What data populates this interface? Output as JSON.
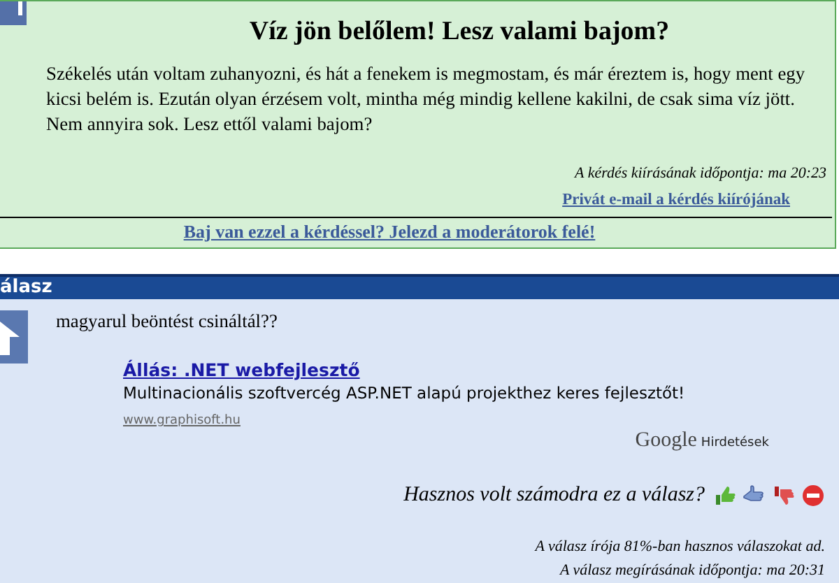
{
  "question": {
    "title": "Víz jön belőlem! Lesz valami bajom?",
    "body": "Székelés után voltam zuhanyozni, és hát a fenekem is megmostam, és már éreztem is, hogy ment egy kicsi belém is. Ezután olyan érzésem volt, mintha még mindig kellene kakilni, de csak sima víz jött. Nem annyira sok. Lesz ettől valami bajom?",
    "posted": "A kérdés kiírásának időpontja: ma 20:23",
    "private_email_link": "Privát e-mail a kérdés kiírójának",
    "report_link": "Baj van ezzel a kérdéssel? Jelezd a moderátorok felé!"
  },
  "answer": {
    "header": "álasz",
    "text": "magyarul beöntést csináltál??",
    "ad": {
      "title": "Állás: .NET webfejlesztő",
      "description": "Multinacionális szoftvercég ASP.NET alapú projekthez keres fejlesztőt!",
      "url": "www.graphisoft.hu",
      "brand": "Google",
      "brand_label": "Hirdetések"
    },
    "rating_prompt": "Hasznos volt számodra ez a válasz?",
    "author_stat": "A válasz írója 81%-ban hasznos válaszokat ad.",
    "posted": "A válasz megírásának időpontja: ma 20:31"
  }
}
